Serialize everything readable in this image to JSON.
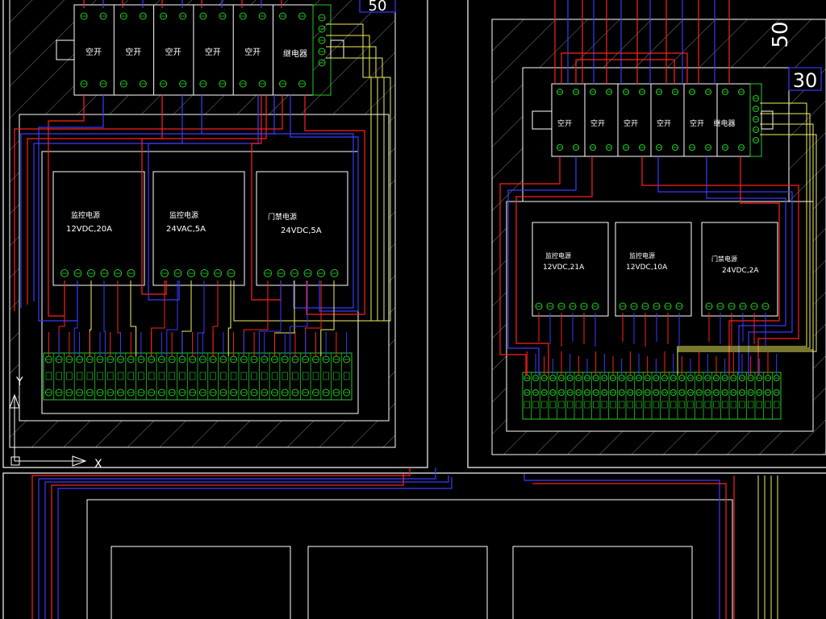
{
  "left_cabinet": {
    "dimension_label": "50",
    "breakers": [
      "空开",
      "空开",
      "空开",
      "空开",
      "空开"
    ],
    "relay": "继电器",
    "power_supplies": [
      {
        "title": "监控电源",
        "rating": "12VDC,20A"
      },
      {
        "title": "监控电源",
        "rating": "24VAC,5A"
      },
      {
        "title": "门禁电源",
        "rating": "24VDC,5A"
      }
    ]
  },
  "right_cabinet": {
    "dimension_label_top": "50",
    "dimension_label_side": "30",
    "breakers": [
      "空开",
      "空开",
      "空开",
      "空开",
      "空开"
    ],
    "relay": "继电器",
    "power_supplies": [
      {
        "title": "监控电源",
        "rating": "12VDC,21A"
      },
      {
        "title": "监控电源",
        "rating": "12VDC,10A"
      },
      {
        "title": "门禁电源",
        "rating": "24VDC,2A"
      }
    ]
  },
  "ucs": {
    "x_label": "X",
    "y_label": "Y"
  },
  "colors": {
    "background": "#000000",
    "outline": "#ffffff",
    "wire_red": "#ff2020",
    "wire_blue": "#3a3aff",
    "wire_yellow": "#f0f060",
    "terminal_green": "#22cc22",
    "hatch": "#9a9a9a"
  }
}
